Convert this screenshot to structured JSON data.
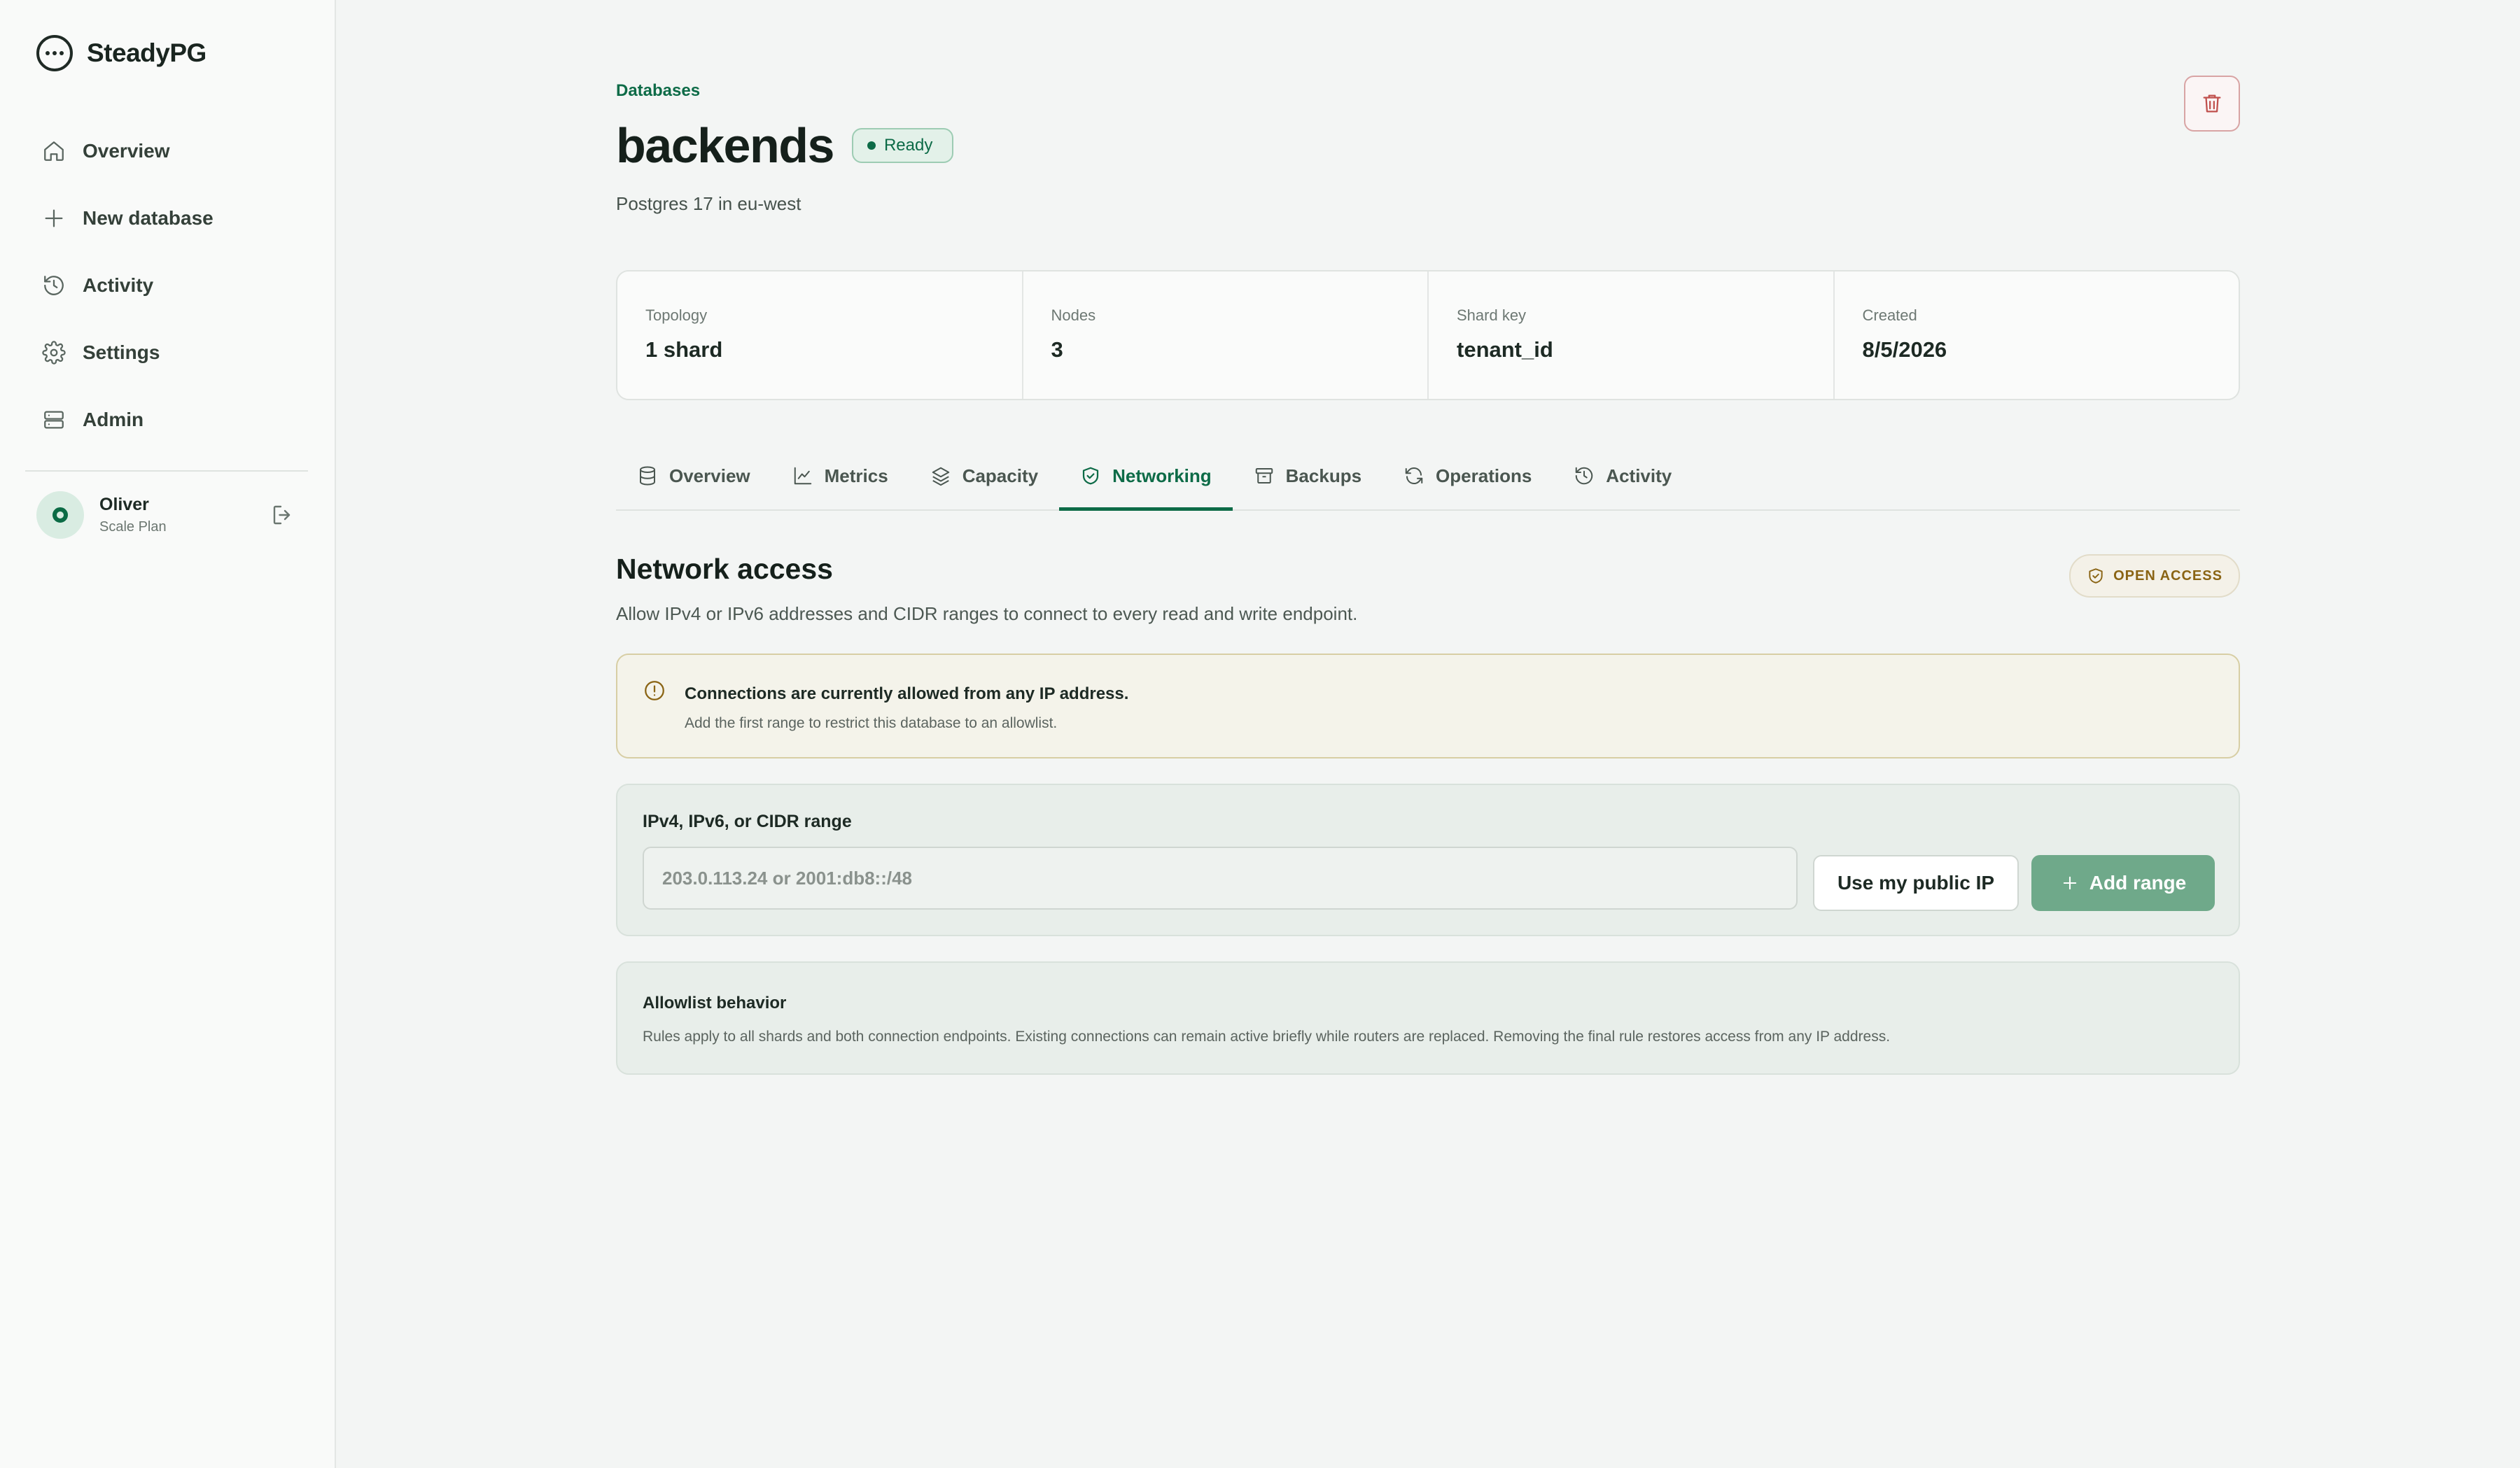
{
  "app": {
    "name": "SteadyPG"
  },
  "sidebar": {
    "items": [
      {
        "label": "Overview",
        "icon": "home-icon"
      },
      {
        "label": "New database",
        "icon": "plus-icon"
      },
      {
        "label": "Activity",
        "icon": "history-icon"
      },
      {
        "label": "Settings",
        "icon": "gear-icon"
      },
      {
        "label": "Admin",
        "icon": "server-icon"
      }
    ],
    "user": {
      "name": "Oliver",
      "plan": "Scale Plan"
    }
  },
  "header": {
    "breadcrumb": "Databases",
    "title": "backends",
    "status": "Ready",
    "subtitle": "Postgres 17 in eu-west"
  },
  "stats": [
    {
      "label": "Topology",
      "value": "1 shard"
    },
    {
      "label": "Nodes",
      "value": "3"
    },
    {
      "label": "Shard key",
      "value": "tenant_id"
    },
    {
      "label": "Created",
      "value": "8/5/2026"
    }
  ],
  "tabs": [
    {
      "label": "Overview",
      "icon": "database-icon"
    },
    {
      "label": "Metrics",
      "icon": "chart-icon"
    },
    {
      "label": "Capacity",
      "icon": "layers-icon"
    },
    {
      "label": "Networking",
      "icon": "shield-check-icon",
      "active": true
    },
    {
      "label": "Backups",
      "icon": "archive-icon"
    },
    {
      "label": "Operations",
      "icon": "refresh-icon"
    },
    {
      "label": "Activity",
      "icon": "history-icon"
    }
  ],
  "network": {
    "title": "Network access",
    "description": "Allow IPv4 or IPv6 addresses and CIDR ranges to connect to every read and write endpoint.",
    "badge": "OPEN ACCESS",
    "alert": {
      "title": "Connections are currently allowed from any IP address.",
      "text": "Add the first range to restrict this database to an allowlist."
    },
    "range": {
      "label": "IPv4, IPv6, or CIDR range",
      "placeholder": "203.0.113.24 or 2001:db8::/48",
      "value": "",
      "public_ip_label": "Use my public IP",
      "add_label": "Add range"
    },
    "behavior": {
      "title": "Allowlist behavior",
      "text": "Rules apply to all shards and both connection endpoints. Existing connections can remain active briefly while routers are replaced. Removing the final rule restores access from any IP address."
    }
  },
  "colors": {
    "accent": "#0d6b47",
    "add_button": "#6fa98a",
    "warning": "#8a6414",
    "danger": "#c0504d"
  }
}
